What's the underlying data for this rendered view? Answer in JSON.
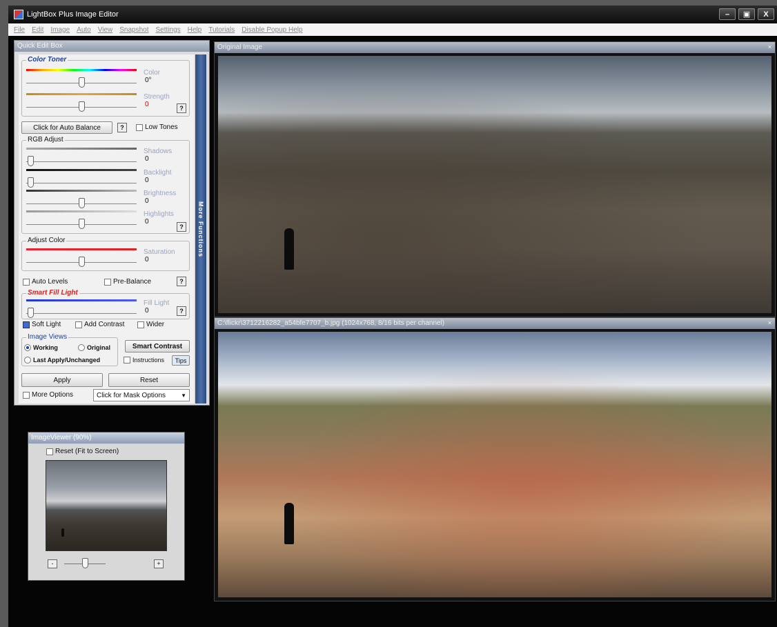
{
  "window": {
    "title": "LightBox Plus Image Editor",
    "controls": [
      "–",
      "▣",
      "X"
    ]
  },
  "menu": [
    "File",
    "Edit",
    "Image",
    "Auto",
    "View",
    "Snapshot",
    "Settings",
    "Help",
    "Tutorials",
    "Disable Popup Help"
  ],
  "quick_edit": {
    "title": "Quick Edit Box",
    "more_functions": "More Functions",
    "color_toner": {
      "legend": "Color Toner",
      "color_label": "Color",
      "color_value": "0°",
      "strength_label": "Strength",
      "strength_value": "0",
      "help": "?"
    },
    "auto_balance": {
      "button": "Click for Auto Balance",
      "help": "?",
      "low_tones": "Low Tones"
    },
    "rgb_adjust": {
      "legend": "RGB Adjust",
      "sliders": [
        {
          "label": "Shadows",
          "value": "0"
        },
        {
          "label": "Backlight",
          "value": "0"
        },
        {
          "label": "Brightness",
          "value": "0"
        },
        {
          "label": "Highlights",
          "value": "0"
        }
      ],
      "help": "?"
    },
    "adjust_color": {
      "legend": "Adjust Color",
      "label": "Saturation",
      "value": "0"
    },
    "auto_levels": "Auto Levels",
    "pre_balance": "Pre-Balance",
    "pre_balance_help": "?",
    "smart_fill": {
      "legend": "Smart Fill Light",
      "label": "Fill Light",
      "value": "0",
      "help": "?",
      "soft_light": "Soft Light",
      "add_contrast": "Add Contrast",
      "wider": "Wider"
    },
    "image_views": {
      "legend": "Image Views",
      "working": "Working",
      "original": "Original",
      "last_apply": "Last Apply/Unchanged",
      "smart_contrast": "Smart Contrast",
      "instructions": "Instructions",
      "tips": "Tips"
    },
    "apply": "Apply",
    "reset": "Reset",
    "more_options": "More Options",
    "mask_options": "Click for Mask Options"
  },
  "viewer": {
    "title": "ImageViewer (90%)",
    "reset_fit": "Reset (Fit to Screen)",
    "zoom_out": "-",
    "zoom_in": "+"
  },
  "original_pane": {
    "title": "Original Image"
  },
  "edited_pane": {
    "title": "C:\\flickr\\3712216282_a54bfe7707_b.jpg (1024x768, 8/16 bits per channel)"
  },
  "colors": {
    "accent": "#3d6bd1",
    "strip": "#2d4a7c",
    "smart_fill_legend": "#d62020"
  }
}
